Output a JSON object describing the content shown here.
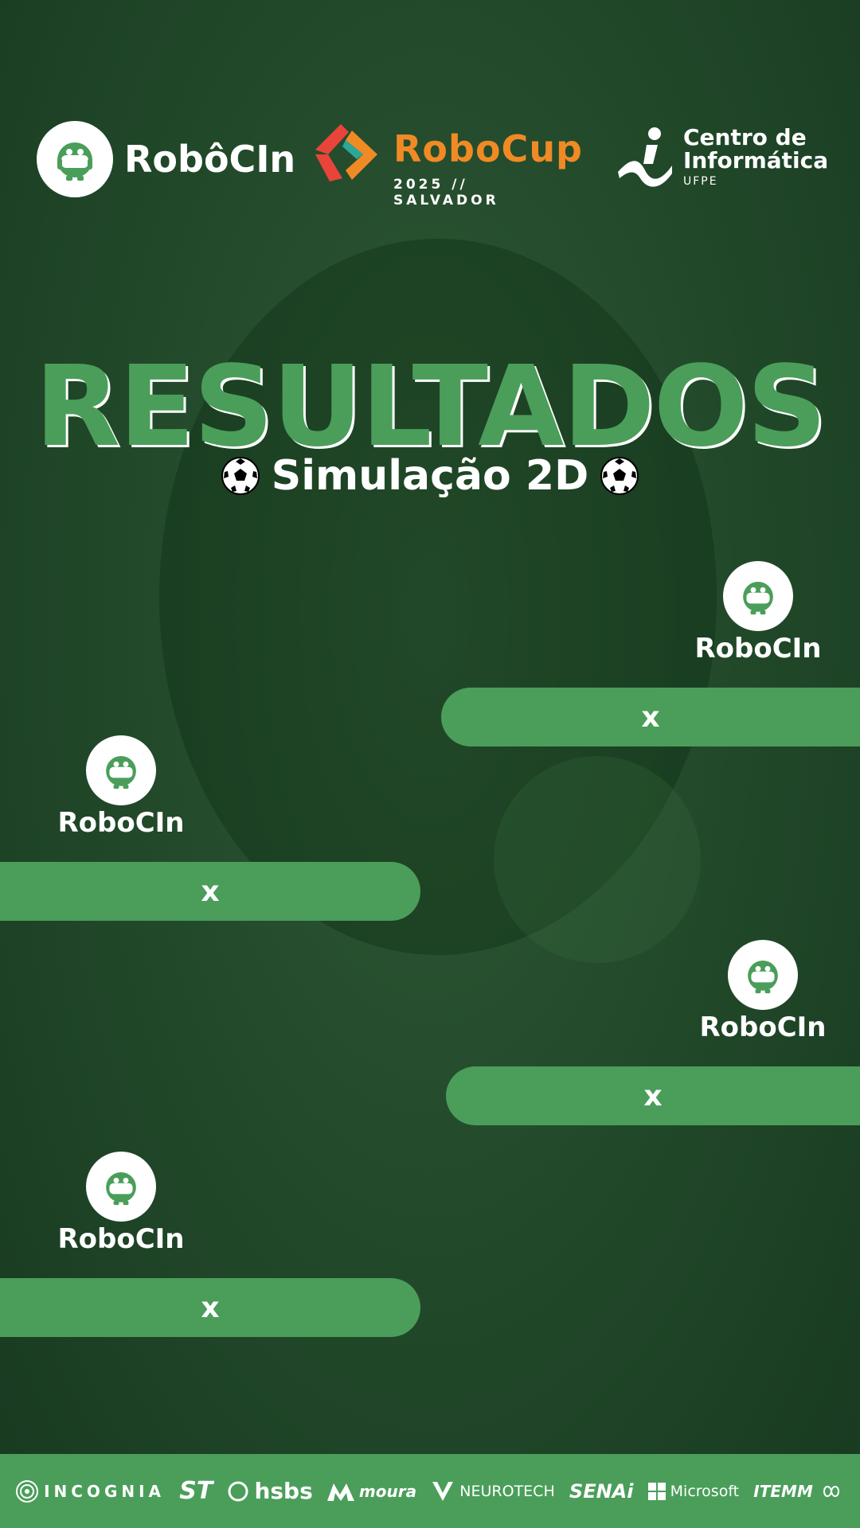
{
  "header": {
    "robocin_logo_text": "RobôCIn",
    "robocup_word": "RoboCup",
    "robocup_sub": "2025 // SALVADOR",
    "cin_line1": "Centro de",
    "cin_line2": "Informática",
    "cin_sub": "UFPE"
  },
  "title": "RESULTADOS",
  "subtitle": "Simulação 2D",
  "matches": [
    {
      "team": "RoboCIn",
      "score": "x"
    },
    {
      "team": "RoboCIn",
      "score": "x"
    },
    {
      "team": "RoboCIn",
      "score": "x"
    },
    {
      "team": "RoboCIn",
      "score": "x"
    }
  ],
  "sponsors": [
    "INCOGNIA",
    "ST",
    "hsbs",
    "moura",
    "NEUROTECH",
    "SENAi",
    "Microsoft",
    "ITEMM"
  ],
  "colors": {
    "accent": "#4a9e5a",
    "background": "#234a2b"
  }
}
